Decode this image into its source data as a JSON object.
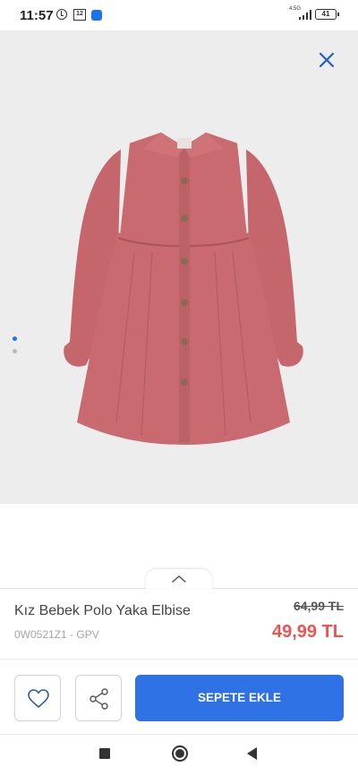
{
  "status_bar": {
    "time": "11:57",
    "calendar_day": "12",
    "network": "4.5G",
    "battery": "41"
  },
  "gallery": {
    "close_icon": "close-icon",
    "slide_count": 2,
    "active_slide": 1,
    "accent_color": "#1e73e8",
    "dress_color": "#c86a6f"
  },
  "product": {
    "title": "Kız Bebek Polo Yaka Elbise",
    "code": "0W0521Z1 - GPV",
    "old_price": "64,99 TL",
    "new_price": "49,99 TL",
    "sale_color": "#ef5350"
  },
  "actions": {
    "favorite_icon": "heart-icon",
    "share_icon": "share-icon",
    "add_to_cart_label": "SEPETE EKLE",
    "button_color": "#2f72e6"
  },
  "nav": {
    "recents_icon": "square-icon",
    "home_icon": "home-circle-icon",
    "back_icon": "back-triangle-icon"
  }
}
